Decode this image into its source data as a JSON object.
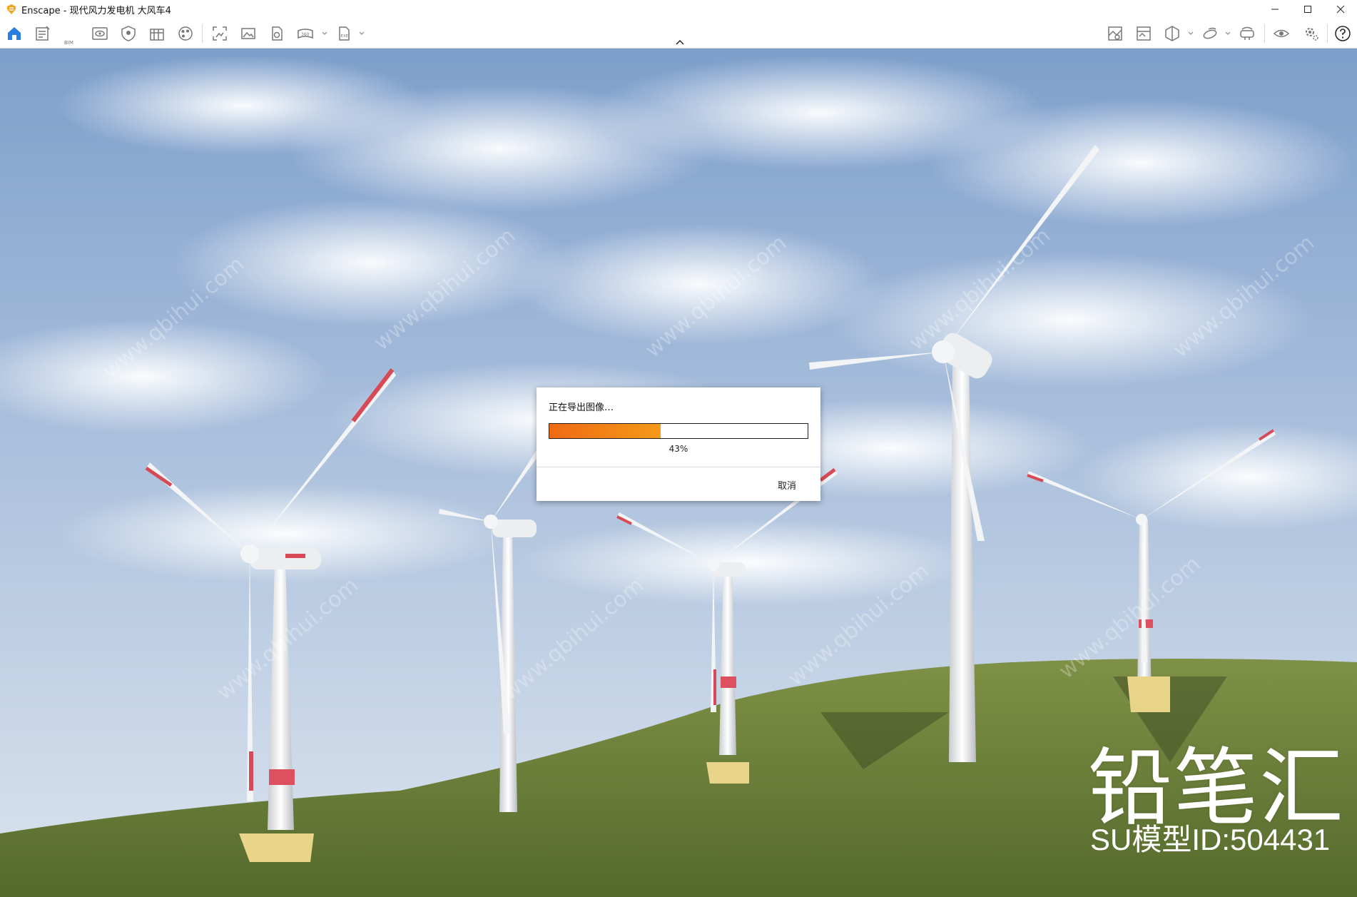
{
  "window": {
    "title": "Enscape - 现代风力发电机 大风车4"
  },
  "toolbar": {
    "left_icons": [
      "home-icon",
      "batch-render-icon",
      "bim-icon",
      "views-icon",
      "visual-settings-icon",
      "asset-library-icon",
      "material-editor-icon",
      "screenshot-icon",
      "render-image-icon",
      "render-video-icon",
      "panorama-icon",
      "export-exe-icon"
    ],
    "bim_label": "BIM",
    "right_icons": [
      "site-context-icon",
      "image-compare-icon",
      "section-icon",
      "orbit-icon",
      "vr-headset-icon",
      "visibility-icon",
      "settings-icon",
      "help-icon"
    ]
  },
  "dialog": {
    "title": "正在导出图像…",
    "progress": 43,
    "percent_label": "43%",
    "cancel_label": "取消"
  },
  "watermark": {
    "brand": "铅笔汇",
    "model_id": "SU模型ID:504431",
    "url_text": "www.qbihui.com"
  },
  "colors": {
    "accent": "#2a7de1",
    "progress_start": "#f06a12",
    "progress_end": "#f59a1a"
  }
}
